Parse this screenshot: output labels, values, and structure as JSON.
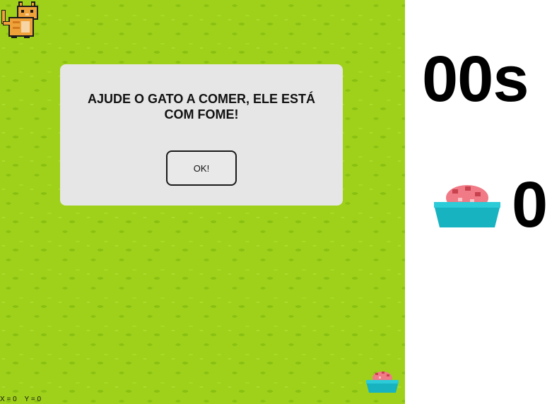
{
  "dialog": {
    "message": "AJUDE O GATO A COMER, ELE ESTÁ COM FOME!",
    "ok_label": "OK!"
  },
  "hud": {
    "timer": "00s",
    "food_count": "0",
    "coords": "X = 0    Y = 0"
  },
  "icons": {
    "player": "cat-icon",
    "food": "food-bowl-icon"
  },
  "colors": {
    "grass": "#9fd11a",
    "dialog_bg": "#e6e6e6",
    "bowl": "#17b3c1",
    "meat": "#f07a85"
  }
}
